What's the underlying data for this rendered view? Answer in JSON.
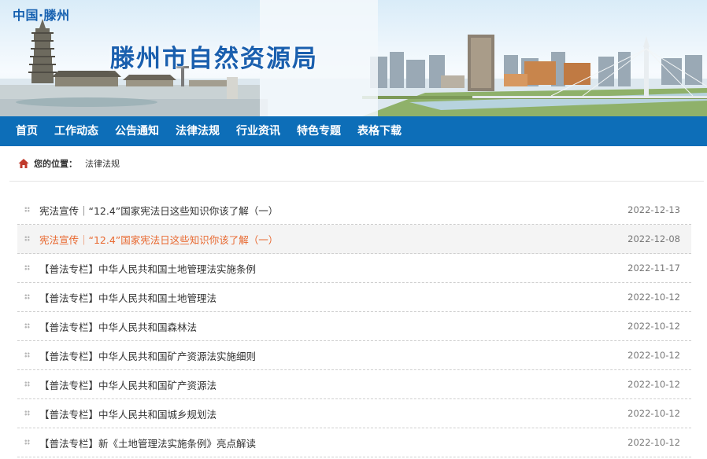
{
  "header": {
    "logo": "中国·滕州",
    "site_title": "滕州市自然资源局"
  },
  "nav": {
    "items": [
      "首页",
      "工作动态",
      "公告通知",
      "法律法规",
      "行业资讯",
      "特色专题",
      "表格下载"
    ]
  },
  "breadcrumb": {
    "label": "您的位置：",
    "current": "法律法规",
    "icon": "home-icon"
  },
  "colors": {
    "nav_bg": "#0d6eb8",
    "title_blue": "#1a5fae",
    "active_link": "#e8682f"
  },
  "list": {
    "items": [
      {
        "title": "宪法宣传｜“12.4”国家宪法日这些知识你该了解（一）",
        "date": "2022-12-13"
      },
      {
        "title": "宪法宣传｜“12.4”国家宪法日这些知识你该了解（一）",
        "date": "2022-12-08"
      },
      {
        "title": "【普法专栏】中华人民共和国土地管理法实施条例",
        "date": "2022-11-17"
      },
      {
        "title": "【普法专栏】中华人民共和国土地管理法",
        "date": "2022-10-12"
      },
      {
        "title": "【普法专栏】中华人民共和国森林法",
        "date": "2022-10-12"
      },
      {
        "title": "【普法专栏】中华人民共和国矿产资源法实施细则",
        "date": "2022-10-12"
      },
      {
        "title": "【普法专栏】中华人民共和国矿产资源法",
        "date": "2022-10-12"
      },
      {
        "title": "【普法专栏】中华人民共和国城乡规划法",
        "date": "2022-10-12"
      },
      {
        "title": "【普法专栏】新《土地管理法实施条例》亮点解读",
        "date": "2022-10-12"
      }
    ]
  }
}
